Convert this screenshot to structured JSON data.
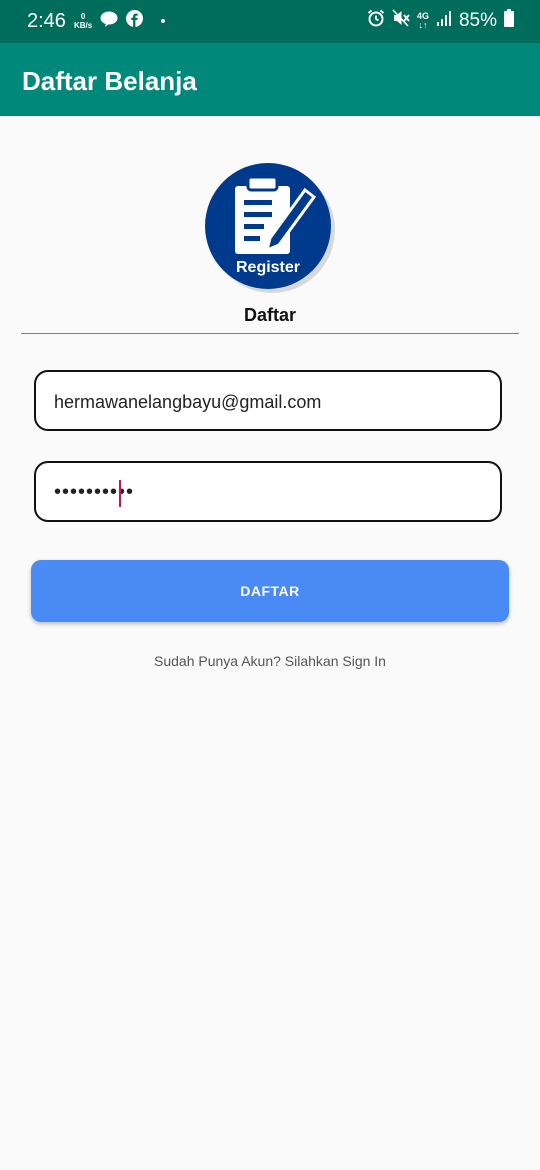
{
  "status_bar": {
    "time": "2:46",
    "net_speed_value": "0",
    "net_speed_unit": "KB/s",
    "network_type": "4G",
    "battery": "85%"
  },
  "app_bar": {
    "title": "Daftar Belanja"
  },
  "logo": {
    "text": "Register"
  },
  "form": {
    "heading": "Daftar",
    "email_value": "hermawanelangbayu@gmail.com",
    "password_value": "••••••••••",
    "submit_label": "DAFTAR"
  },
  "signin_link": "Sudah Punya Akun? Silahkan Sign In",
  "colors": {
    "status_bar": "#006c5c",
    "app_bar": "#00897b",
    "button": "#4a8af4",
    "logo_circle": "#003a8c"
  }
}
